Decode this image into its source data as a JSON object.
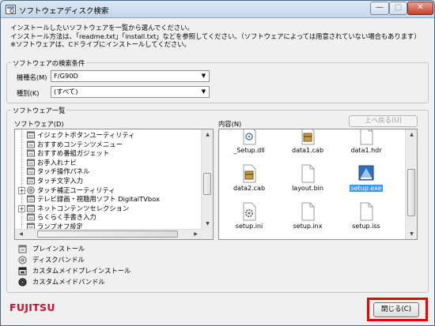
{
  "window": {
    "title": "ソフトウェアディスク検索",
    "controls": {
      "minimize": "—",
      "maximize": "□",
      "close": "✕"
    }
  },
  "intro": {
    "line1": "インストールしたいソフトウェアを一覧から選んでください。",
    "line2": "インストール方法は、「readme.txt」「install.txt」などを参照してください。（ソフトウェアによっては用意されていない場合もあります）",
    "line3": "※ソフトウェアは、Cドライブにインストールしてください。"
  },
  "search": {
    "group_label": "ソフトウェアの検索条件",
    "model_label": "機種名(M)",
    "model_value": "F/G90D",
    "type_label": "種別(K)",
    "type_value": "(すべて)"
  },
  "software_list": {
    "group_label": "ソフトウェア一覧",
    "tree_label": "ソフトウェア(D)",
    "items": [
      {
        "label": "イジェクトボタンユーティリティ",
        "icon": "install-icon"
      },
      {
        "label": "おすすめコンテンツメニュー",
        "icon": "install-icon"
      },
      {
        "label": "おすすめ番組ガジェット",
        "icon": "install-icon"
      },
      {
        "label": "お手入れナビ",
        "icon": "install-icon"
      },
      {
        "label": "タッチ操作パネル",
        "icon": "install-icon"
      },
      {
        "label": "タッチ文字入力",
        "icon": "install-icon"
      },
      {
        "label": "タッチ補正ユーティリティ",
        "icon": "disc-icon"
      },
      {
        "label": "テレビ録画・視聴用ソフト DigitalTVbox",
        "icon": "install-icon"
      },
      {
        "label": "ネットコンテンツセレクション",
        "icon": "install-icon"
      },
      {
        "label": "らくらく手書き入力",
        "icon": "install-icon"
      },
      {
        "label": "ランプオフ設定",
        "icon": "install-icon"
      }
    ],
    "content_label": "内容(N)",
    "up_button": "上へ戻る(U)",
    "files": [
      {
        "name": "_Setup.dll",
        "icon": "dll-file-icon"
      },
      {
        "name": "data1.cab",
        "icon": "cab-file-icon"
      },
      {
        "name": "data1.hdr",
        "icon": "generic-file-icon"
      },
      {
        "name": "data2.cab",
        "icon": "cab-file-icon"
      },
      {
        "name": "layout.bin",
        "icon": "generic-file-icon"
      },
      {
        "name": "setup.exe",
        "icon": "setup-exe-icon"
      },
      {
        "name": "setup.ini",
        "icon": "ini-file-icon"
      },
      {
        "name": "setup.inx",
        "icon": "generic-file-icon"
      },
      {
        "name": "setup.iss",
        "icon": "generic-file-icon"
      }
    ],
    "selected_file": "setup.exe"
  },
  "legend": [
    {
      "label": "プレインストール",
      "icon": "preinstall-icon"
    },
    {
      "label": "ディスクバンドル",
      "icon": "disc-bundle-icon"
    },
    {
      "label": "カスタムメイドプレインストール",
      "icon": "custom-preinstall-icon"
    },
    {
      "label": "カスタムメイドバンドル",
      "icon": "custom-bundle-icon"
    }
  ],
  "footer": {
    "brand": "FUJITSU",
    "close_button": "閉じる(C)"
  },
  "colors": {
    "brand_red": "#c8102e",
    "selection_blue": "#3399ff",
    "highlight_red": "#e00000"
  }
}
